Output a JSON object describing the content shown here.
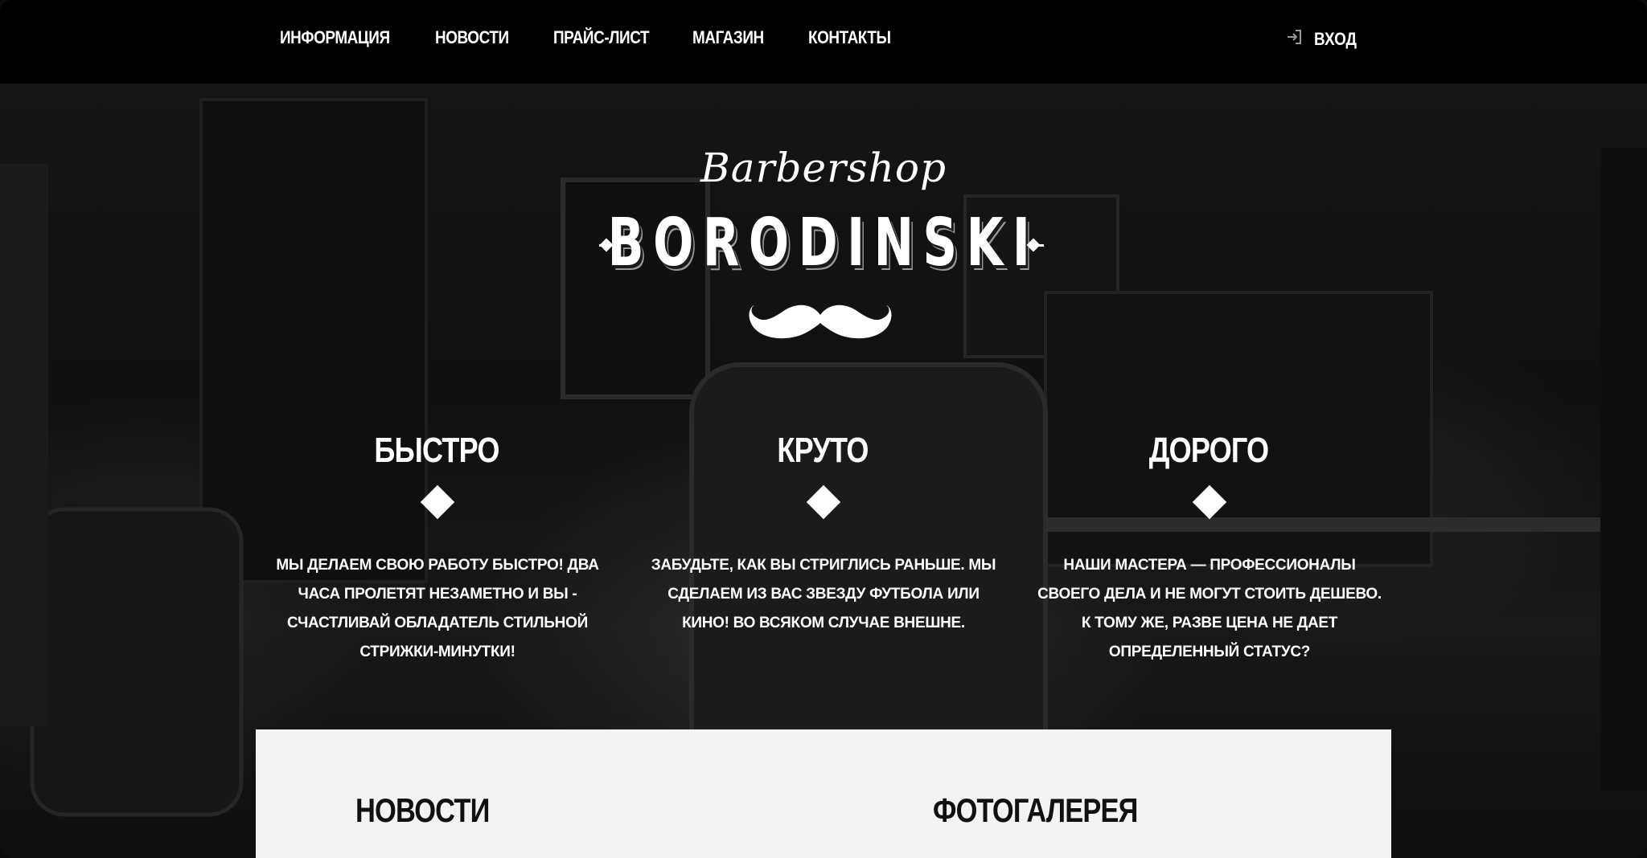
{
  "nav": {
    "items": [
      {
        "label": "ИНФОРМАЦИЯ"
      },
      {
        "label": "НОВОСТИ"
      },
      {
        "label": "ПРАЙС-ЛИСТ"
      },
      {
        "label": "МАГАЗИН"
      },
      {
        "label": "КОНТАКТЫ"
      }
    ],
    "login_label": "ВХОД",
    "login_icon": "login-icon"
  },
  "hero": {
    "logo_script": "Barbershop",
    "logo_name": "BORODINSKI",
    "logo_icon": "mustache-icon",
    "features": [
      {
        "title": "БЫСТРО",
        "text": "МЫ ДЕЛАЕМ СВОЮ РАБОТУ БЫСТРО! ДВА ЧАСА ПРОЛЕТЯТ НЕЗАМЕТНО И ВЫ - СЧАСТЛИВАЙ ОБЛАДАТЕЛЬ СТИЛЬНОЙ СТРИЖКИ-МИНУТКИ!"
      },
      {
        "title": "КРУТО",
        "text": "ЗАБУДЬТЕ, КАК ВЫ СТРИГЛИСЬ РАНЬШЕ. МЫ СДЕЛАЕМ ИЗ ВАС ЗВЕЗДУ ФУТБОЛА ИЛИ КИНО! ВО ВСЯКОМ СЛУЧАЕ ВНЕШНЕ."
      },
      {
        "title": "ДОРОГО",
        "text": "НАШИ МАСТЕРА — ПРОФЕССИОНАЛЫ СВОЕГО ДЕЛА И НЕ МОГУТ СТОИТЬ ДЕШЕВО. К ТОМУ ЖЕ, РАЗВЕ ЦЕНА НЕ ДАЕТ ОПРЕДЕЛЕННЫЙ СТАТУС?"
      }
    ]
  },
  "content": {
    "news_heading": "НОВОСТИ",
    "gallery_heading": "ФОТОГАЛЕРЕЯ"
  },
  "colors": {
    "nav_background": "#000000",
    "panel_background": "#f3f3f3",
    "text_light": "#ffffff",
    "text_dark": "#111111"
  }
}
